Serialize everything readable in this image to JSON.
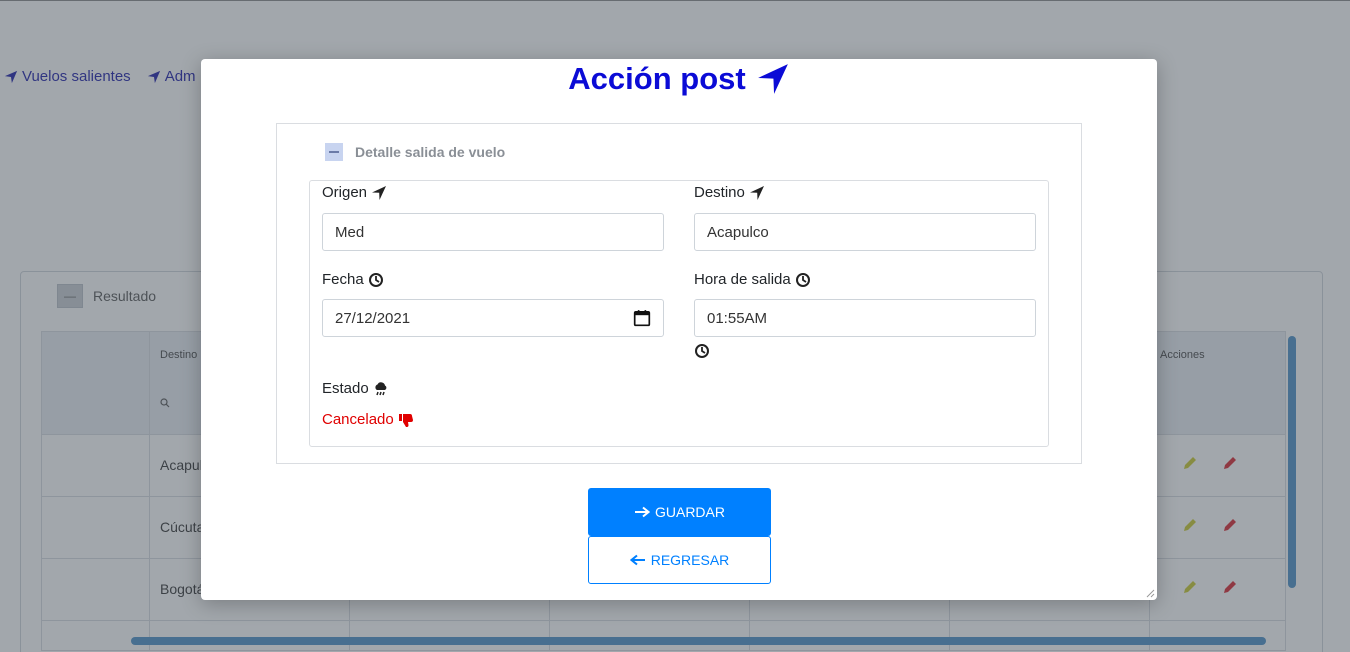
{
  "background": {
    "nav": [
      {
        "label": "Vuelos salientes"
      },
      {
        "label": "Adm"
      }
    ],
    "panel_title": "Resultado",
    "grid": {
      "headers": [
        "Destino",
        "Acciones"
      ],
      "rows": [
        {
          "destino": "Acapul"
        },
        {
          "destino": "Cúcuta"
        },
        {
          "destino": "Bogotá"
        }
      ]
    }
  },
  "modal": {
    "title": "Acción post",
    "fieldset_legend": "Detalle salida de vuelo",
    "origen": {
      "label": "Origen",
      "value": "Med"
    },
    "destino": {
      "label": "Destino",
      "value": "Acapulco"
    },
    "fecha": {
      "label": "Fecha",
      "value": "27/12/2021"
    },
    "hora": {
      "label": "Hora de salida",
      "value": "01:55AM"
    },
    "estado": {
      "label": "Estado",
      "value": "Cancelado"
    },
    "save_button": "GUARDAR",
    "back_button": "REGRESAR"
  },
  "colors": {
    "title": "#0b0bd6",
    "primary": "#0080ff",
    "cancelled": "#e00000",
    "edit_yellow": "#c9c92a",
    "edit_red": "#d9232d"
  }
}
